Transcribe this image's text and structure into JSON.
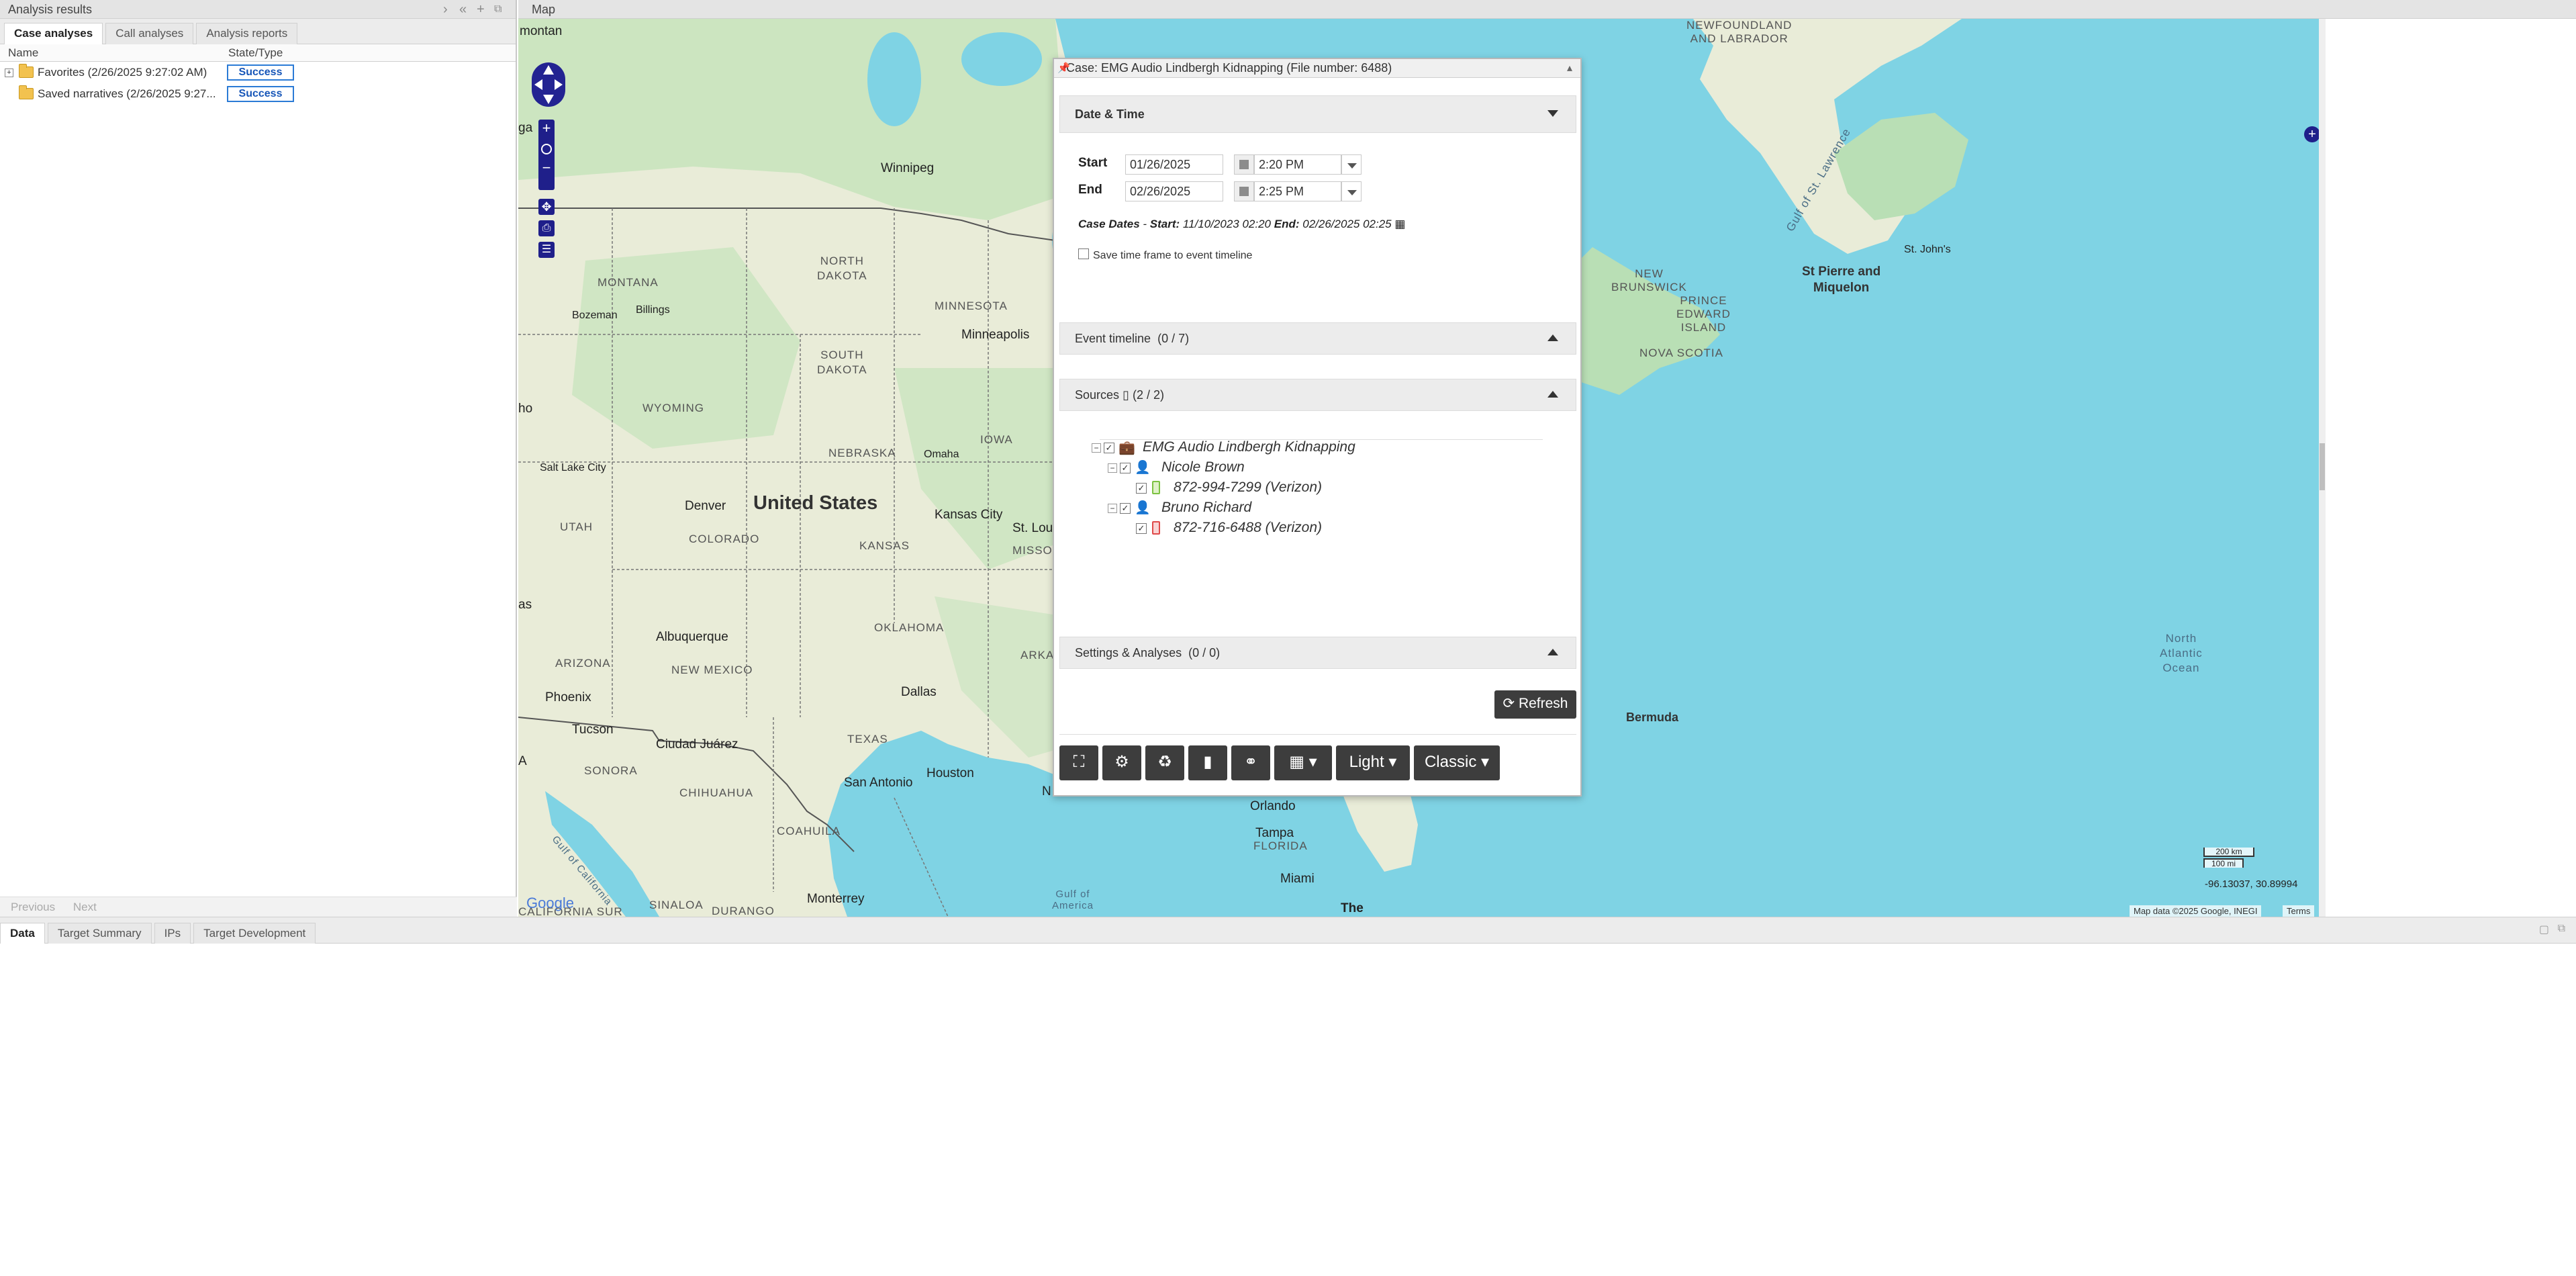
{
  "left_panel": {
    "title": "Analysis results",
    "tabs": [
      "Case analyses",
      "Call analyses",
      "Analysis reports"
    ],
    "columns": [
      "Name",
      "State/Type"
    ],
    "rows": [
      {
        "name": "Favorites (2/26/2025 9:27:02 AM)",
        "state": "Success",
        "expander": "+"
      },
      {
        "name": "Saved narratives (2/26/2025 9:27...",
        "state": "Success",
        "expander": ""
      }
    ],
    "pager": {
      "previous": "Previous",
      "next": "Next"
    }
  },
  "map_panel": {
    "title": "Map",
    "labels": {
      "montana_top": "montan",
      "newfoundland": "NEWFOUNDLAND\nAND LABRADOR",
      "winnipeg": "Winnipeg",
      "gulf_st_lawrence": "Gulf of St. Lawrence",
      "montana": "MONTANA",
      "north_dakota": "NORTH\nDAKOTA",
      "minnesota": "MINNESOTA",
      "bozeman": "Bozeman",
      "billings": "Billings",
      "minneapolis": "Minneapolis",
      "south_dakota": "SOUTH\nDAKOTA",
      "wyoming": "WYOMING",
      "iowa": "IOWA",
      "nebraska": "NEBRASKA",
      "omaha": "Omaha",
      "salt_lake": "Salt Lake City",
      "denver": "Denver",
      "united_states": "United States",
      "kansas_city": "Kansas City",
      "st_lou": "St. Lou",
      "utah": "UTAH",
      "colorado": "COLORADO",
      "kansas": "KANSAS",
      "missouri": "MISSOURI",
      "albuquerque": "Albuquerque",
      "oklahoma": "OKLAHOMA",
      "arkansas": "ARKANSAS",
      "arizona": "ARIZONA",
      "new_mexico": "NEW MEXICO",
      "phoenix": "Phoenix",
      "dallas": "Dallas",
      "tucson": "Tucson",
      "ciudad_juarez": "Ciudad Juárez",
      "texas": "TEXAS",
      "sonora": "SONORA",
      "chihuahua": "CHIHUAHUA",
      "san_antonio": "San Antonio",
      "houston": "Houston",
      "coahuila": "COAHUILA",
      "sinaloa": "SINALOA",
      "durango": "DURANGO",
      "monterrey": "Monterrey",
      "gulf_mexico": "Gulf of\nAmerica",
      "orlando": "Orlando",
      "tampa": "Tampa",
      "florida": "FLORIDA",
      "miami": "Miami",
      "the": "The",
      "gulf_california": "Gulf of California",
      "baja": "CALIFORNIA SUR",
      "as_left": "as",
      "ga_left": "ga",
      "ho_left": "ho",
      "a_left": "A",
      "new_brunswick": "NEW\nBRUNSWICK",
      "prince_edward": "PRINCE\nEDWARD\nISLAND",
      "nova_scotia": "NOVA SCOTIA",
      "st_pierre": "St Pierre and\nMiquelon",
      "st_johns": "St. John's",
      "north_atlantic": "North\nAtlantic\nOcean",
      "bermuda": "Bermuda",
      "n_edge": "N",
      "google": "Google"
    },
    "scale": {
      "km": "200 km",
      "mi": "100 mi"
    },
    "coords": "-96.13037, 30.89994",
    "attribution": "Map data ©2025 Google, INEGI",
    "terms": "Terms"
  },
  "dialog": {
    "title": "Case: EMG Audio Lindbergh Kidnapping (File number: 6488)",
    "date_time": {
      "header": "Date & Time",
      "start_label": "Start",
      "end_label": "End",
      "start_date": "01/26/2025",
      "start_time": "2:20 PM",
      "end_date": "02/26/2025",
      "end_time": "2:25 PM",
      "case_dates_prefix": "Case Dates",
      "case_dates_start_label": "Start:",
      "case_dates_start": "11/10/2023 02:20",
      "case_dates_end_label": "End:",
      "case_dates_end": "02/26/2025 02:25",
      "save_checkbox_label": "Save time frame to event timeline"
    },
    "event_timeline": {
      "header": "Event timeline",
      "count": "(0 / 7)"
    },
    "sources": {
      "header": "Sources",
      "count": "(2 / 2)",
      "tree": {
        "case": "EMG Audio Lindbergh Kidnapping",
        "people": [
          {
            "name": "Nicole Brown",
            "phone": "872-994-7299 (Verizon)",
            "phone_color": "#7cc242"
          },
          {
            "name": "Bruno Richard",
            "phone": "872-716-6488 (Verizon)",
            "phone_color": "#e04a4a"
          }
        ]
      }
    },
    "settings": {
      "header": "Settings & Analyses",
      "count": "(0 / 0)"
    },
    "refresh_label": "Refresh",
    "toolbar": {
      "light_label": "Light",
      "classic_label": "Classic"
    }
  },
  "bottom_panel": {
    "tabs": [
      "Data",
      "Target Summary",
      "IPs",
      "Target Development"
    ]
  },
  "colors": {
    "map_water": "#7fd3e4",
    "map_land": "#e9ecd8",
    "land_green": "#b9dfb5",
    "badge_blue": "#2b7bd6",
    "dark_button": "#3d3d3d",
    "control_navy": "#1f1f8a"
  }
}
